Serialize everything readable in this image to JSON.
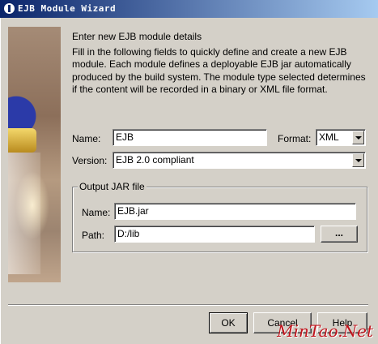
{
  "window": {
    "title": "EJB Module Wizard"
  },
  "heading": "Enter new EJB module details",
  "description": "Fill in the following fields to quickly define and create a new EJB module.  Each module defines a deployable EJB jar automatically produced by the build system.  The module type selected determines if the content will be recorded in a binary or XML file format.",
  "form": {
    "name_label": "Name:",
    "name_value": "EJB",
    "format_label": "Format:",
    "format_value": "XML",
    "version_label": "Version:",
    "version_value": "EJB 2.0 compliant"
  },
  "output_jar": {
    "group_title": "Output JAR file",
    "name_label": "Name:",
    "name_value": "EJB.jar",
    "path_label": "Path:",
    "path_value": "D:/lib",
    "browse_label": "..."
  },
  "buttons": {
    "ok": "OK",
    "cancel": "Cancel",
    "help": "Help"
  },
  "watermark": "MinTao.Net",
  "icons": {
    "title": "app-icon",
    "browse": "ellipsis-icon",
    "dropdown": "chevron-down-icon"
  }
}
